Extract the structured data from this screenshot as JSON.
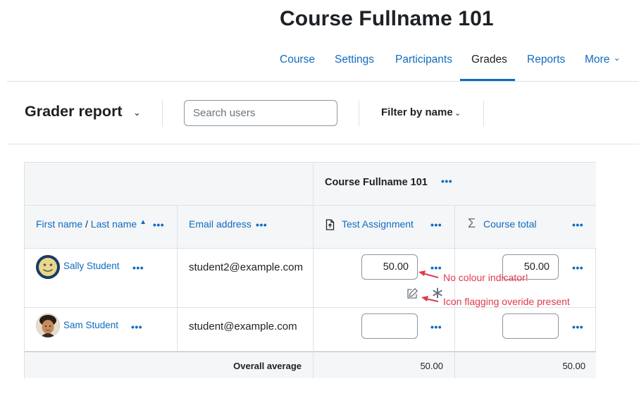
{
  "course": {
    "title": "Course Fullname 101"
  },
  "nav": {
    "items": [
      {
        "label": "Course"
      },
      {
        "label": "Settings"
      },
      {
        "label": "Participants"
      },
      {
        "label": "Grades",
        "active": true
      },
      {
        "label": "Reports"
      },
      {
        "label": "More"
      }
    ],
    "more_caret": "⌄"
  },
  "toolbar": {
    "report_title": "Grader report",
    "report_caret": "⌄",
    "search_placeholder": "Search users",
    "filter_label": "Filter by name",
    "filter_caret": "⌄"
  },
  "table": {
    "category_header": "Course Fullname 101",
    "columns": {
      "first_name": "First name",
      "separator": "/",
      "last_name": "Last name",
      "sort_indicator": "▲",
      "email": "Email address",
      "assignment": "Test Assignment",
      "course_total": "Course total"
    },
    "actions_label": "•••",
    "rows": [
      {
        "name": "Sally Student",
        "email": "student2@example.com",
        "assignment_grade": "50.00",
        "course_total": "50.00",
        "override_icons": true
      },
      {
        "name": "Sam Student",
        "email": "student@example.com",
        "assignment_grade": "",
        "course_total": ""
      }
    ],
    "average": {
      "label": "Overall average",
      "assignment": "50.00",
      "course_total": "50.00"
    }
  },
  "annotations": {
    "note1": "No colour indicator!",
    "note2": "Icon flagging overide present",
    "color": "#e03a4e"
  },
  "colors": {
    "link": "#0f6cbf",
    "border": "#dee2e6",
    "header_bg": "#f5f6f8"
  }
}
